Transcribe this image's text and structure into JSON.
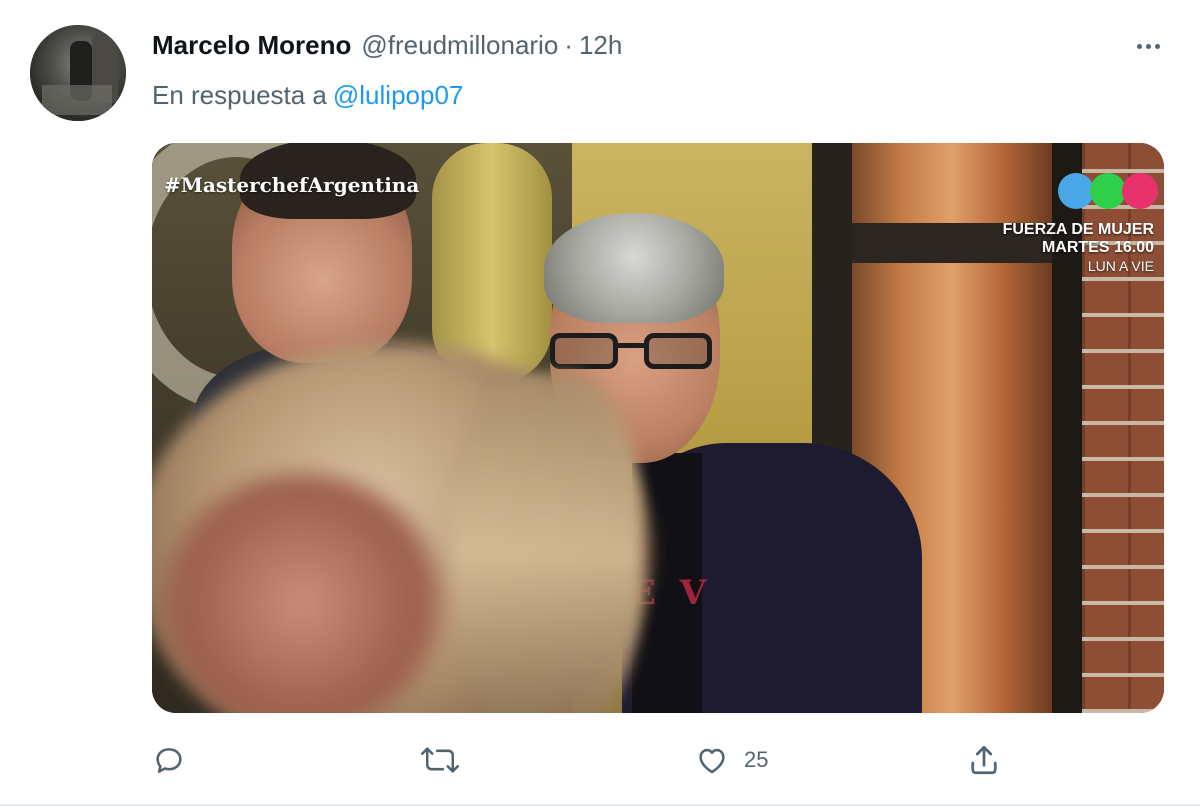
{
  "tweet": {
    "author": {
      "display_name": "Marcelo Moreno",
      "handle": "@freudmillonario"
    },
    "separator": "·",
    "timestamp": "12h",
    "reply_to": {
      "prefix": "En respuesta a",
      "mention": "@lulipop07"
    },
    "media": {
      "watermark": "#MasterchefArgentina",
      "promo": {
        "line1": "FUERZA DE MUJER",
        "line2": "MARTES 16.00",
        "line3": "LUN A VIE"
      },
      "shirt_print": "E V"
    },
    "actions": {
      "reply_icon": "reply-icon",
      "retweet_icon": "retweet-icon",
      "like_icon": "like-icon",
      "like_count": "25",
      "share_icon": "share-icon"
    },
    "more_icon": "more-horizontal-icon"
  },
  "colors": {
    "text_primary": "#0f1419",
    "text_secondary": "#536471",
    "link": "#1d9bf0"
  }
}
